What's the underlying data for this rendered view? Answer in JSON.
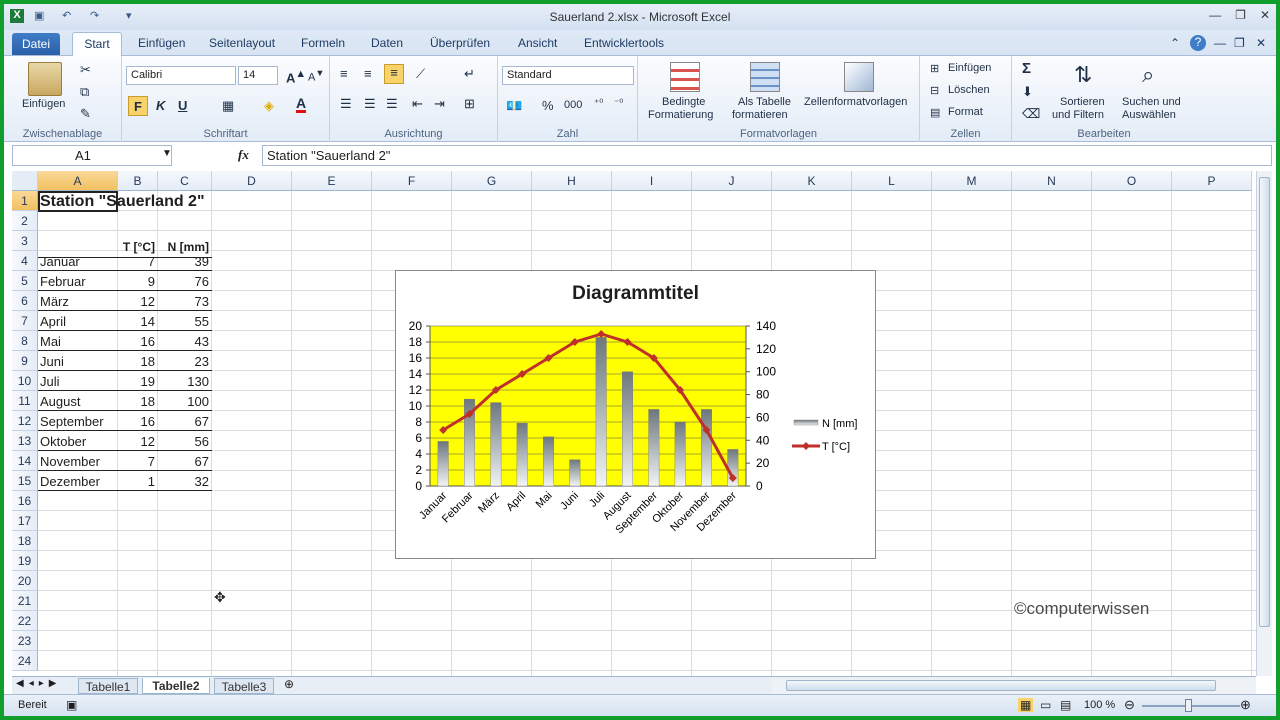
{
  "window": {
    "title": "Sauerland 2.xlsx - Microsoft Excel"
  },
  "ribbon_tabs": {
    "file": "Datei",
    "active": "Start",
    "others": [
      "Einfügen",
      "Seitenlayout",
      "Formeln",
      "Daten",
      "Überprüfen",
      "Ansicht",
      "Entwicklertools"
    ]
  },
  "ribbon": {
    "clipboard": {
      "paste": "Einfügen",
      "label": "Zwischenablage"
    },
    "font": {
      "name": "Calibri",
      "size": "14",
      "bold": "F",
      "italic": "K",
      "underline": "U",
      "label": "Schriftart"
    },
    "alignment": {
      "label": "Ausrichtung"
    },
    "number": {
      "format": "Standard",
      "label": "Zahl",
      "percent": "%",
      "thousands": "000"
    },
    "styles": {
      "conditional": [
        "Bedingte",
        "Formatierung"
      ],
      "astable": [
        "Als Tabelle",
        "formatieren"
      ],
      "cellstyles": "Zellenformatvorlagen",
      "label": "Formatvorlagen"
    },
    "cells": {
      "insert": "Einfügen",
      "delete": "Löschen",
      "format": "Format",
      "label": "Zellen"
    },
    "editing": {
      "sort": [
        "Sortieren",
        "und Filtern"
      ],
      "find": [
        "Suchen und",
        "Auswählen"
      ],
      "label": "Bearbeiten"
    }
  },
  "formula_bar": {
    "name_box": "A1",
    "fx": "fx",
    "content": "Station \"Sauerland 2\""
  },
  "columns": [
    "A",
    "B",
    "C",
    "D",
    "E",
    "F",
    "G",
    "H",
    "I",
    "J",
    "K",
    "L",
    "M",
    "N",
    "O",
    "P"
  ],
  "rows": [
    "1",
    "2",
    "3",
    "4",
    "5",
    "6",
    "7",
    "8",
    "9",
    "10",
    "11",
    "12",
    "13",
    "14",
    "15",
    "16",
    "17",
    "18",
    "19",
    "20",
    "21",
    "22",
    "23",
    "24"
  ],
  "sheet": {
    "a1": "Station \"Sauerland 2\"",
    "header_t": "T [°C]",
    "header_n": "N [mm]",
    "months": [
      "Januar",
      "Februar",
      "März",
      "April",
      "Mai",
      "Juni",
      "Juli",
      "August",
      "September",
      "Oktober",
      "November",
      "Dezember"
    ],
    "temps": [
      "7",
      "9",
      "12",
      "14",
      "16",
      "18",
      "19",
      "18",
      "16",
      "12",
      "7",
      "1"
    ],
    "precip": [
      "39",
      "76",
      "73",
      "55",
      "43",
      "23",
      "130",
      "100",
      "67",
      "56",
      "67",
      "32"
    ]
  },
  "chart_data": {
    "type": "bar",
    "title": "Diagrammtitel",
    "categories": [
      "Januar",
      "Februar",
      "März",
      "April",
      "Mai",
      "Juni",
      "Juli",
      "August",
      "September",
      "Oktober",
      "November",
      "Dezember"
    ],
    "series": [
      {
        "name": "N [mm]",
        "type": "bar",
        "axis": "secondary",
        "values": [
          39,
          76,
          73,
          55,
          43,
          23,
          130,
          100,
          67,
          56,
          67,
          32
        ]
      },
      {
        "name": "T [°C]",
        "type": "line",
        "axis": "primary",
        "values": [
          7,
          9,
          12,
          14,
          16,
          18,
          19,
          18,
          16,
          12,
          7,
          1
        ]
      }
    ],
    "y_left": {
      "range": [
        0,
        20
      ],
      "ticks": [
        "0",
        "2",
        "4",
        "6",
        "8",
        "10",
        "12",
        "14",
        "16",
        "18",
        "20"
      ]
    },
    "y_right": {
      "range": [
        0,
        140
      ],
      "ticks": [
        "0",
        "20",
        "40",
        "60",
        "80",
        "100",
        "120",
        "140"
      ]
    },
    "plot_background": "#ffff00",
    "bar_color": "#8c969c",
    "line_color": "#c0302a",
    "legend": "right"
  },
  "sheet_tabs": [
    "Tabelle1",
    "Tabelle2",
    "Tabelle3"
  ],
  "active_sheet": "Tabelle2",
  "status": {
    "ready": "Bereit",
    "zoom": "100 %"
  },
  "watermark": "©computerwissen"
}
